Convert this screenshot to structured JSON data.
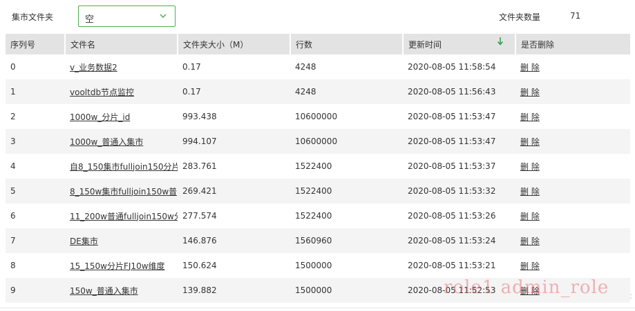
{
  "filter": {
    "label": "集市文件夹",
    "selected": "空",
    "count_label": "文件夹数量",
    "count_value": "71"
  },
  "table": {
    "columns": [
      "序列号",
      "文件名",
      "文件夹大小（M）",
      "行数",
      "更新时间",
      "是否删除"
    ],
    "sort_column": "更新时间",
    "sort_direction": "desc",
    "rows": [
      {
        "idx": "0",
        "name": "v_业务数据2",
        "size": "0.17",
        "rows": "4248",
        "time": "2020-08-05 11:58:54",
        "action": "删 除"
      },
      {
        "idx": "1",
        "name": "vooltdb节点监控",
        "size": "0.17",
        "rows": "4248",
        "time": "2020-08-05 11:56:43",
        "action": "删 除"
      },
      {
        "idx": "2",
        "name": "1000w_分片_id",
        "size": "993.438",
        "rows": "10600000",
        "time": "2020-08-05 11:53:47",
        "action": "删 除"
      },
      {
        "idx": "3",
        "name": "1000w_普通入集市",
        "size": "994.107",
        "rows": "10600000",
        "time": "2020-08-05 11:53:47",
        "action": "删 除"
      },
      {
        "idx": "4",
        "name": "自8_150集市fulljoin150分片",
        "size": "283.761",
        "rows": "1522400",
        "time": "2020-08-05 11:53:37",
        "action": "删 除"
      },
      {
        "idx": "5",
        "name": "8_150w集市fulljoin150w普",
        "size": "269.421",
        "rows": "1522400",
        "time": "2020-08-05 11:53:32",
        "action": "删 除"
      },
      {
        "idx": "6",
        "name": "11_200w普通fulljoin150w分",
        "size": "277.574",
        "rows": "1522400",
        "time": "2020-08-05 11:53:26",
        "action": "删 除"
      },
      {
        "idx": "7",
        "name": "DE集市",
        "size": "146.876",
        "rows": "1560960",
        "time": "2020-08-05 11:53:24",
        "action": "删 除"
      },
      {
        "idx": "8",
        "name": "15_150w分片FJ10w维度",
        "size": "150.624",
        "rows": "1500000",
        "time": "2020-08-05 11:53:21",
        "action": "删 除"
      },
      {
        "idx": "9",
        "name": "150w_普通入集市",
        "size": "139.882",
        "rows": "1500000",
        "time": "2020-08-05 11:52:53",
        "action": "删 除"
      }
    ]
  },
  "watermark": "role1 admin_role",
  "colors": {
    "select_border": "#4caf50",
    "sort_arrow": "#2e9a4a",
    "header_bg": "#e3e3e3",
    "stripe_bg": "#f4f4f4"
  },
  "icons": {
    "select_chevron": "chevron-down-icon",
    "sort_indicator": "sort-down-arrow-icon"
  }
}
